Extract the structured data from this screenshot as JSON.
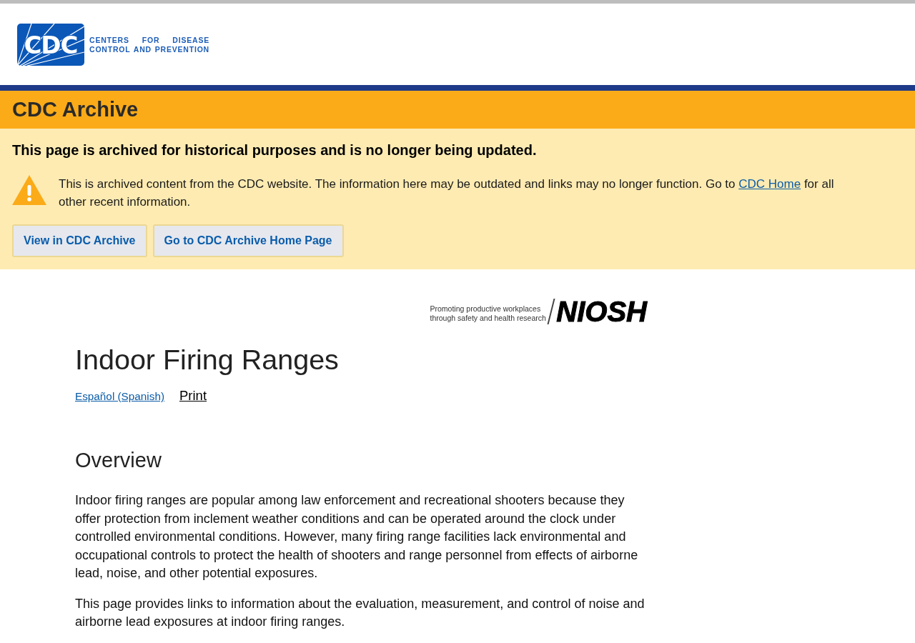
{
  "logo": {
    "letters": "CDC",
    "lines": [
      "CENTERS FOR DISEASE",
      "CONTROL AND PREVENTION"
    ]
  },
  "archive_banner": {
    "title": "CDC Archive",
    "heading": "This page is archived for historical purposes and is no longer being updated.",
    "notice": {
      "text_before": "This is archived content from the CDC website. The information here may be outdated and links may no longer function. Go to",
      "link": "CDC Home",
      "text_after": "for all other recent information."
    },
    "buttons": [
      "View in CDC Archive",
      "Go to CDC Archive Home Page"
    ]
  },
  "niosh_banner": {
    "tagline": [
      "Promoting productive workplaces",
      "through safety and health research"
    ],
    "wordmark": "NIOSH"
  },
  "page": {
    "title": "Indoor Firing Ranges",
    "links": [
      {
        "label": "Español (Spanish)",
        "kind": "language"
      },
      {
        "label": "Print",
        "kind": "print"
      }
    ],
    "section": {
      "heading": "Overview",
      "paragraphs": [
        "Indoor firing ranges are popular among law enforcement and recreational shooters because they offer protection from inclement weather conditions and can be operated around the clock under controlled environmental conditions. However, many firing range facilities lack environmental and occupational controls to protect the health of shooters and range personnel from effects of airborne lead, noise, and other potential exposures.",
        "This page provides links to information about the evaluation, measurement, and control of noise and airborne lead exposures at indoor firing ranges."
      ]
    }
  }
}
